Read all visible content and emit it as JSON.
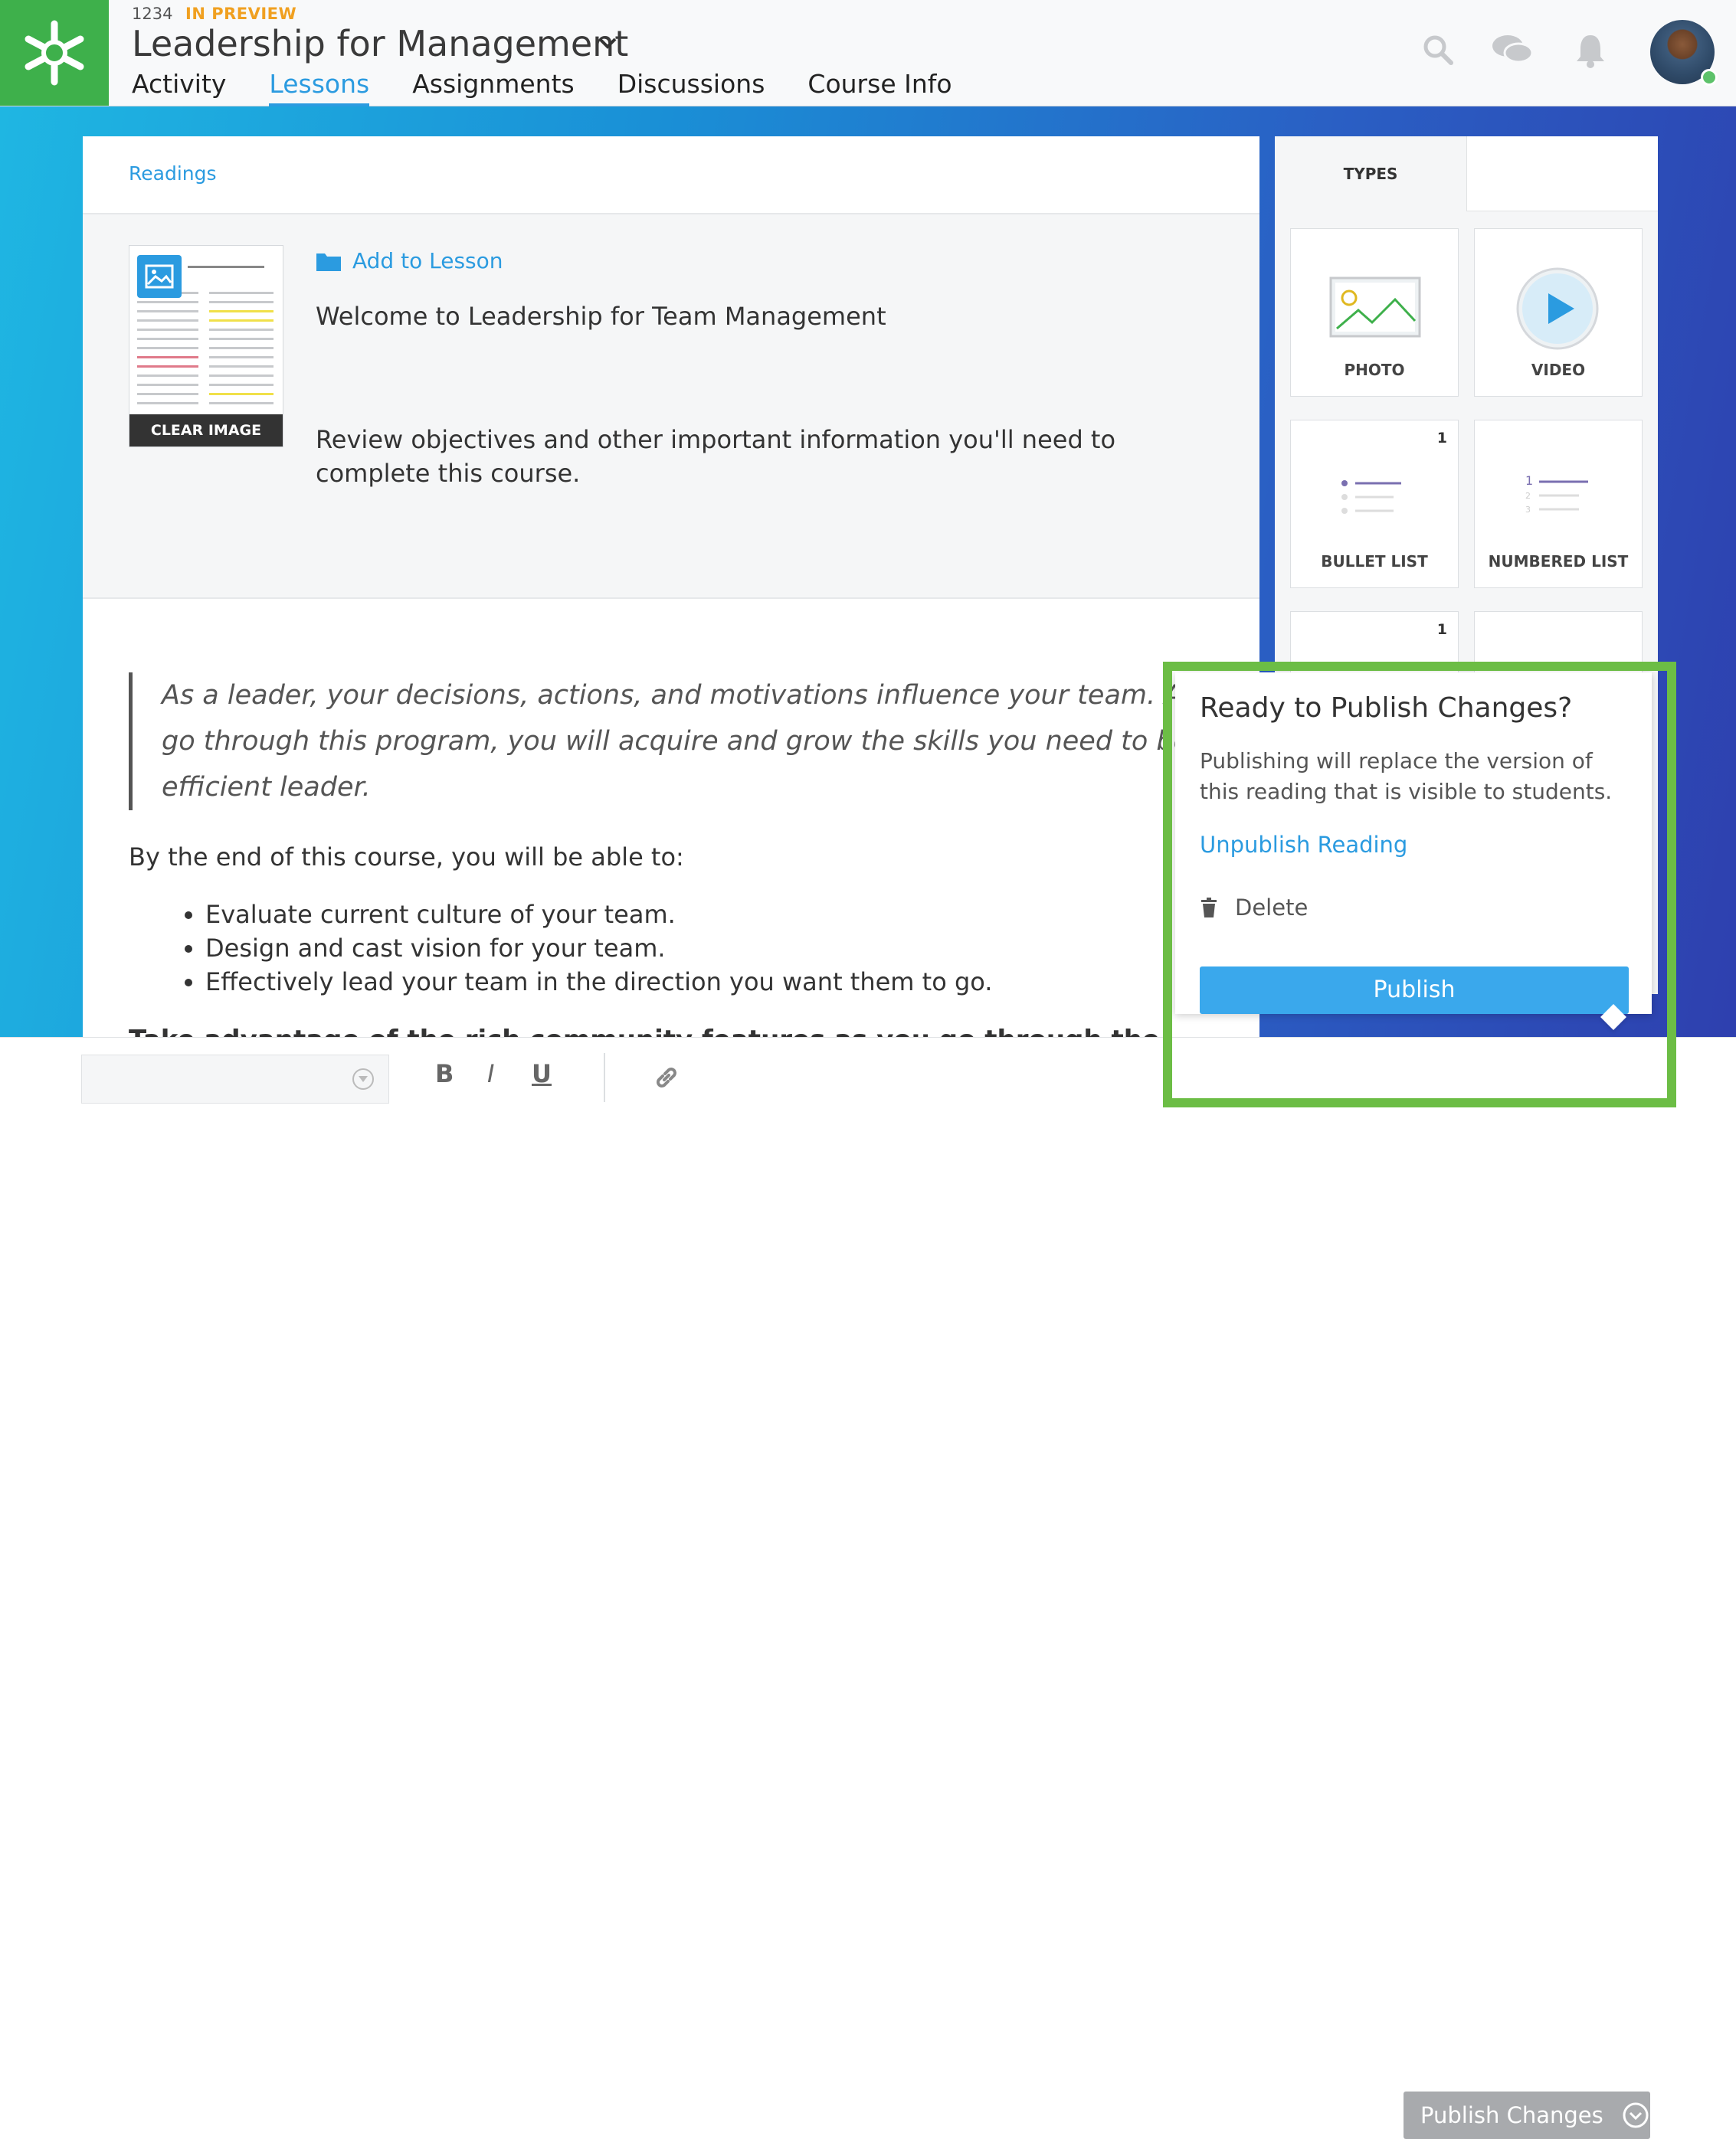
{
  "header": {
    "course_id": "1234",
    "status": "IN PREVIEW",
    "course_title": "Leadership for Management",
    "nav": [
      "Activity",
      "Lessons",
      "Assignments",
      "Discussions",
      "Course Info"
    ],
    "active_nav": "Lessons"
  },
  "colors": {
    "brand_green": "#3eb04b",
    "accent_blue": "#2b9be0",
    "preview_orange": "#f0a020",
    "highlight_green": "#6cbd45"
  },
  "card": {
    "section": "Readings",
    "clear_image": "CLEAR IMAGE",
    "add_to_lesson": "Add to Lesson",
    "welcome": "Welcome to Leadership for Team Management",
    "review": "Review objectives and other important information you'll need to complete this course.",
    "quote": "As a leader, your decisions, actions, and motivations influence your team. As you go through this program, you will acquire and grow the skills you need to be an efficient leader.",
    "by_end": "By the end of this course, you will be able to:",
    "objectives": [
      "Evaluate current culture of your team.",
      "Design and cast vision for your team.",
      "Effectively lead your team in the direction you want them to go."
    ],
    "cutoff_text": "Take advantage of the rich community features as you go through the program."
  },
  "panel": {
    "tab": "TYPES",
    "tiles": [
      {
        "label": "PHOTO",
        "icon": "photo-icon",
        "count": ""
      },
      {
        "label": "VIDEO",
        "icon": "video-play-icon",
        "count": ""
      },
      {
        "label": "BULLET LIST",
        "icon": "bullet-list-icon",
        "count": "1"
      },
      {
        "label": "NUMBERED LIST",
        "icon": "numbered-list-icon",
        "count": ""
      },
      {
        "label": "",
        "icon": "",
        "count": "1"
      },
      {
        "label": "",
        "icon": "",
        "count": ""
      }
    ]
  },
  "toolbar": {
    "bold": "B",
    "italic": "I",
    "underline": "U",
    "link_icon": "link-icon",
    "dropdown_icon": "chevron-down-icon"
  },
  "popover": {
    "title": "Ready to Publish Changes?",
    "text": "Publishing will replace the version of this reading that is visible to students.",
    "unpublish": "Unpublish Reading",
    "delete": "Delete",
    "publish": "Publish"
  },
  "publish_changes": "Publish Changes"
}
